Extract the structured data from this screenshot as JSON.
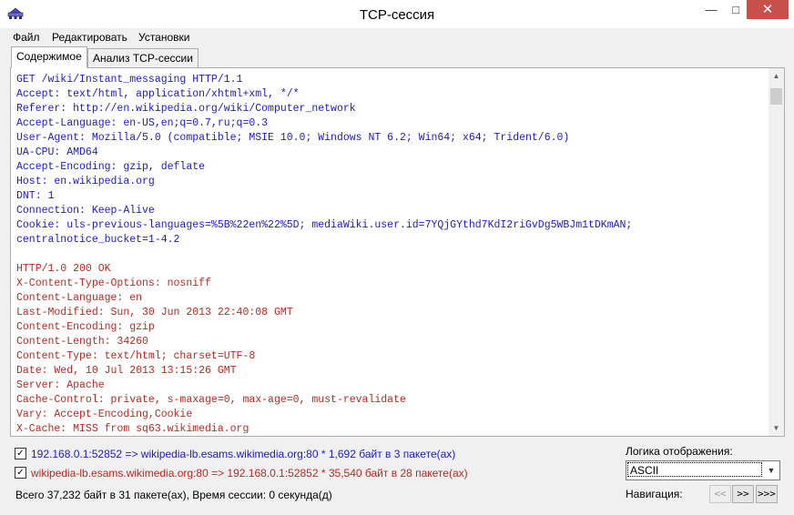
{
  "window": {
    "title": "TCP-сессия",
    "icon": "network-icon",
    "minimize": "—",
    "maximize": "□",
    "close": "✕"
  },
  "menu": [
    "Файл",
    "Редактировать",
    "Установки"
  ],
  "tabs": [
    {
      "label": "Содержимое",
      "active": true
    },
    {
      "label": "Анализ TCP-сессии",
      "active": false
    }
  ],
  "request_lines": [
    "GET /wiki/Instant_messaging HTTP/1.1",
    "Accept: text/html, application/xhtml+xml, */*",
    "Referer: http://en.wikipedia.org/wiki/Computer_network",
    "Accept-Language: en-US,en;q=0.7,ru;q=0.3",
    "User-Agent: Mozilla/5.0 (compatible; MSIE 10.0; Windows NT 6.2; Win64; x64; Trident/6.0)",
    "UA-CPU: AMD64",
    "Accept-Encoding: gzip, deflate",
    "Host: en.wikipedia.org",
    "DNT: 1",
    "Connection: Keep-Alive",
    "Cookie: uls-previous-languages=%5B%22en%22%5D; mediaWiki.user.id=7YQjGYthd7KdI2riGvDg5WBJm1tDKmAN;",
    "centralnotice_bucket=1-4.2"
  ],
  "response_lines": [
    "HTTP/1.0 200 OK",
    "X-Content-Type-Options: nosniff",
    "Content-Language: en",
    "Last-Modified: Sun, 30 Jun 2013 22:40:08 GMT",
    "Content-Encoding: gzip",
    "Content-Length: 34260",
    "Content-Type: text/html; charset=UTF-8",
    "Date: Wed, 10 Jul 2013 13:15:26 GMT",
    "Server: Apache",
    "Cache-Control: private, s-maxage=0, max-age=0, must-revalidate",
    "Vary: Accept-Encoding,Cookie",
    "X-Cache: MISS from sq63.wikimedia.org"
  ],
  "streams": [
    {
      "checked": true,
      "label": "192.168.0.1:52852 => wikipedia-lb.esams.wikimedia.org:80 * 1,692 байт в 3 пакете(ах)",
      "color": "#1a1ad6"
    },
    {
      "checked": true,
      "label": "wikipedia-lb.esams.wikimedia.org:80 => 192.168.0.1:52852 * 35,540 байт в 28 пакете(ах)",
      "color": "#c0271f"
    }
  ],
  "summary": "Всего 37,232 байт в 31 пакете(ах), Время сессии: 0 секунда(д)",
  "display_logic": {
    "label": "Логика отображения:",
    "value": "ASCII"
  },
  "navigation": {
    "label": "Навигация:",
    "buttons": [
      "<<",
      ">>",
      ">>>"
    ]
  }
}
